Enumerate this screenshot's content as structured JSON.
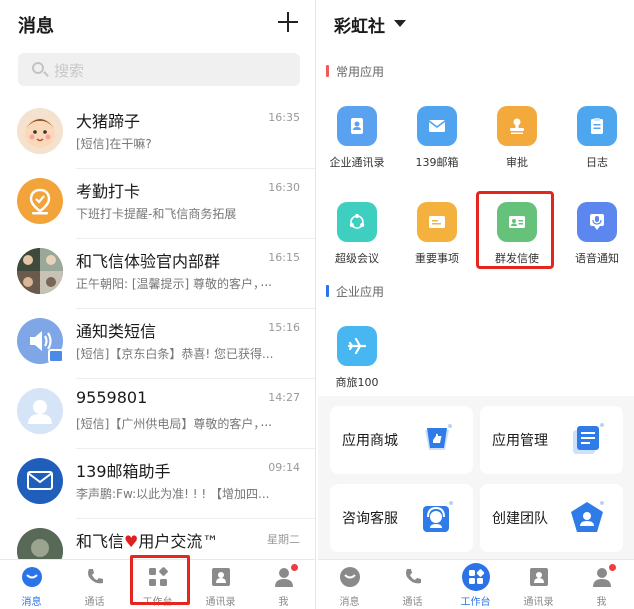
{
  "left": {
    "title": "消息",
    "search_placeholder": "搜索",
    "messages": [
      {
        "name": "大猪蹄子",
        "time": "16:35",
        "preview": "[短信]在干嘛?"
      },
      {
        "name": "考勤打卡",
        "time": "16:30",
        "preview": "下班打卡提醒-和飞信商务拓展"
      },
      {
        "name": "和飞信体验官内部群",
        "time": "16:15",
        "preview": "正午朝阳: [温馨提示] 尊敬的客户，"
      },
      {
        "name": "通知类短信",
        "time": "15:16",
        "preview": "[短信]【京东白条】恭喜! 您已获得..."
      },
      {
        "name": "9559801",
        "time": "14:27",
        "preview": "[短信]【广州供电局】尊敬的客户，"
      },
      {
        "name": "139邮箱助手",
        "time": "09:14",
        "preview": "李声鹏:Fw:以此为准! ! ! 【增加四..."
      },
      {
        "name_a": "和飞信",
        "heart": "♥",
        "name_b": "用户交流™",
        "time": "星期二"
      }
    ],
    "dots": "...",
    "tabs": [
      "消息",
      "通话",
      "工作台",
      "通讯录",
      "我"
    ]
  },
  "right": {
    "title": "彩虹社",
    "sections": {
      "common": "常用应用",
      "enterprise": "企业应用"
    },
    "apps": [
      {
        "label": "企业通讯录",
        "color": "#5aa2ef",
        "icon": "contact-book-icon"
      },
      {
        "label": "139邮箱",
        "color": "#4fa3ef",
        "icon": "mail-icon"
      },
      {
        "label": "审批",
        "color": "#f3a93c",
        "icon": "stamp-icon"
      },
      {
        "label": "日志",
        "color": "#4ea6ef",
        "icon": "clipboard-icon"
      },
      {
        "label": "超级会议",
        "color": "#3fcfc0",
        "icon": "meeting-icon"
      },
      {
        "label": "重要事项",
        "color": "#f5b13d",
        "icon": "pen-note-icon"
      },
      {
        "label": "群发信使",
        "color": "#66c27a",
        "icon": "id-card-icon"
      },
      {
        "label": "语音通知",
        "color": "#5b87ef",
        "icon": "microphone-icon"
      }
    ],
    "enterprise_apps": [
      {
        "label": "商旅100",
        "color": "#47b6f1",
        "icon": "airplane-icon"
      }
    ],
    "cards": [
      {
        "label": "应用商城",
        "icon": "app-store-icon"
      },
      {
        "label": "应用管理",
        "icon": "app-manage-icon"
      },
      {
        "label": "咨询客服",
        "icon": "customer-service-icon"
      },
      {
        "label": "创建团队",
        "icon": "create-team-icon"
      }
    ],
    "tabs": [
      "消息",
      "通话",
      "工作台",
      "通讯录",
      "我"
    ]
  },
  "colors": {
    "accent": "#2a73e8",
    "highlight": "#e5261f",
    "notify_dot": "#f23b3b"
  }
}
